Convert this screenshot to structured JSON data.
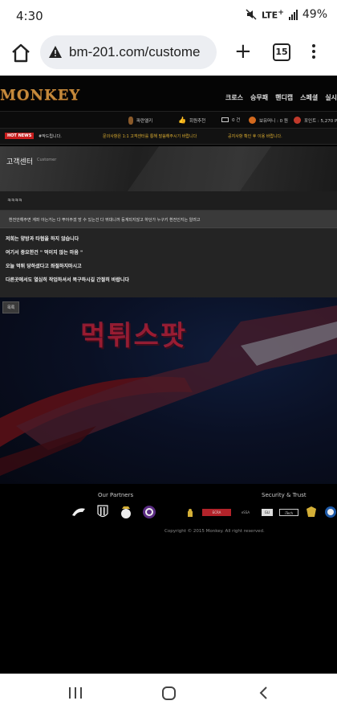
{
  "status_bar": {
    "time": "4:30",
    "network": "LTE",
    "network_sup": "+",
    "battery": "49%"
  },
  "browser": {
    "url": "bm-201.com/custome",
    "tab_count": "15"
  },
  "site": {
    "logo": "MONKEY",
    "nav": [
      "크로스",
      "승무패",
      "핸디캡",
      "스페셜",
      "실시"
    ]
  },
  "user_bar": {
    "level": "파란엘키",
    "recommend": "회원추천",
    "messages": "0 건",
    "money": "보유머니 : 0 원",
    "points": "포인트 : 5,270 P"
  },
  "news": {
    "badge": "HOT NEWS",
    "item1": "#작드립니다.",
    "item2": "문의사항은 1:1 고객센터를 통해 말씀해주시기 바랍니다",
    "item3": "공지사항 확인 후 이용 바랍니다."
  },
  "banner": {
    "title": "고객센터",
    "subtitle": "Customer"
  },
  "post": {
    "title": "ㅋㅋㅋㅋ",
    "meta": "환전안해주면 계좌 아는거는 다 뿌어주겠 망 수 있는건 다 뛰대니까 등계되지않고 하던가 누구키 환전인지는 알려고",
    "lines": [
      "저희는 양방과 타협을 하지 않습니다",
      "여기서 중요한건 \" 먹이지 않는 마음 \"",
      "오늘 먹튀 당하셨다고 좌절하지마시고",
      "다른곳에서도 열심히 작업하셔서 복구하시길 간절히 바랍니다"
    ],
    "list_button": "목록"
  },
  "watermark": "먹튀스팟",
  "footer": {
    "partners_title": "Our Partners",
    "security_title": "Security & Trust",
    "security_labels": [
      "ECRA",
      "eSSA",
      "GLI",
      "iTech"
    ],
    "copyright": "Copyright © 2015 Monkey. All right reserved."
  },
  "colors": {
    "accent_gold": "#c58a3c",
    "hot_red": "#c81e1e",
    "watermark_red": "#d2233c"
  }
}
